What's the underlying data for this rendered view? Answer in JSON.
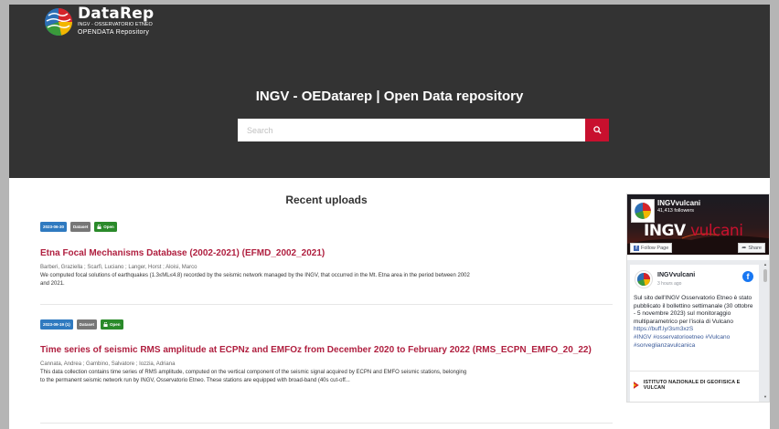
{
  "header": {
    "brand": "DataRep",
    "brand_sub1": "INGV - OSSERVATORIO ETNEO",
    "brand_sub2": "OPENDATA Repository",
    "title": "INGV - OEDatarep | Open Data repository"
  },
  "search": {
    "placeholder": "Search"
  },
  "main": {
    "section_title": "Recent uploads",
    "records": [
      {
        "date": "2023-06-30",
        "type": "Dataset",
        "access": "Open",
        "title": "Etna Focal Mechanisms Database (2002-2021) (EFMD_2002_2021)",
        "authors": "Barberi, Graziella ; Scarfì, Luciano ; Langer, Horst ; Aloisi, Marco",
        "description": "We computed focal solutions of earthquakes (1.3≤ML≤4.8) recorded by the seismic network managed by the INGV, that occurred in the Mt. Etna area in the period between 2002 and 2021."
      },
      {
        "date": "2023-09-19 (1)",
        "type": "Dataset",
        "access": "Open",
        "title": "Time series of seismic RMS amplitude at ECPNz and EMFOz from December 2020 to February 2022 (RMS_ECPN_EMFO_20_22)",
        "authors": "Cannata, Andrea ; Gambino, Salvatore ; Iozzia, Adriana",
        "description": "This data collection contains time series of RMS amplitude, computed on the vertical component of the seismic signal acquired by ECPN and EMFO seismic stations, belonging to the permanent seismic network run by INGV, Osservatorio Etneo. These stations are equipped with broad-band (40s cut-off..."
      }
    ]
  },
  "facebook": {
    "page_name": "INGVvulcani",
    "followers": "41,413 followers",
    "cover_brand_a": "INGV",
    "cover_brand_b": "vulcani",
    "follow_label": "Follow Page",
    "share_label": "Share",
    "post": {
      "author": "INGVvulcani",
      "time": "3 hours ago",
      "text": "Sul sito dell'INGV Osservatorio Etneo è stato pubblicato il bollettino settimanale (30 ottobre - 5 novembre 2023) sul monitoraggio multiparametrico per l'isola di Vulcano",
      "link": "https://buff.ly/3sm3xzS",
      "hashtags": "#INGV #osservatorioetneo #Vulcano #sorveglianzavulcanica",
      "org": "ISTITUTO NAZIONALE DI GEOFISICA E VULCAN"
    }
  },
  "colors": {
    "accent": "#c8102e",
    "hero_bg": "#333333",
    "title_red": "#b02040",
    "date_badge": "#2f7ac0",
    "open_badge": "#2a8a2a"
  }
}
